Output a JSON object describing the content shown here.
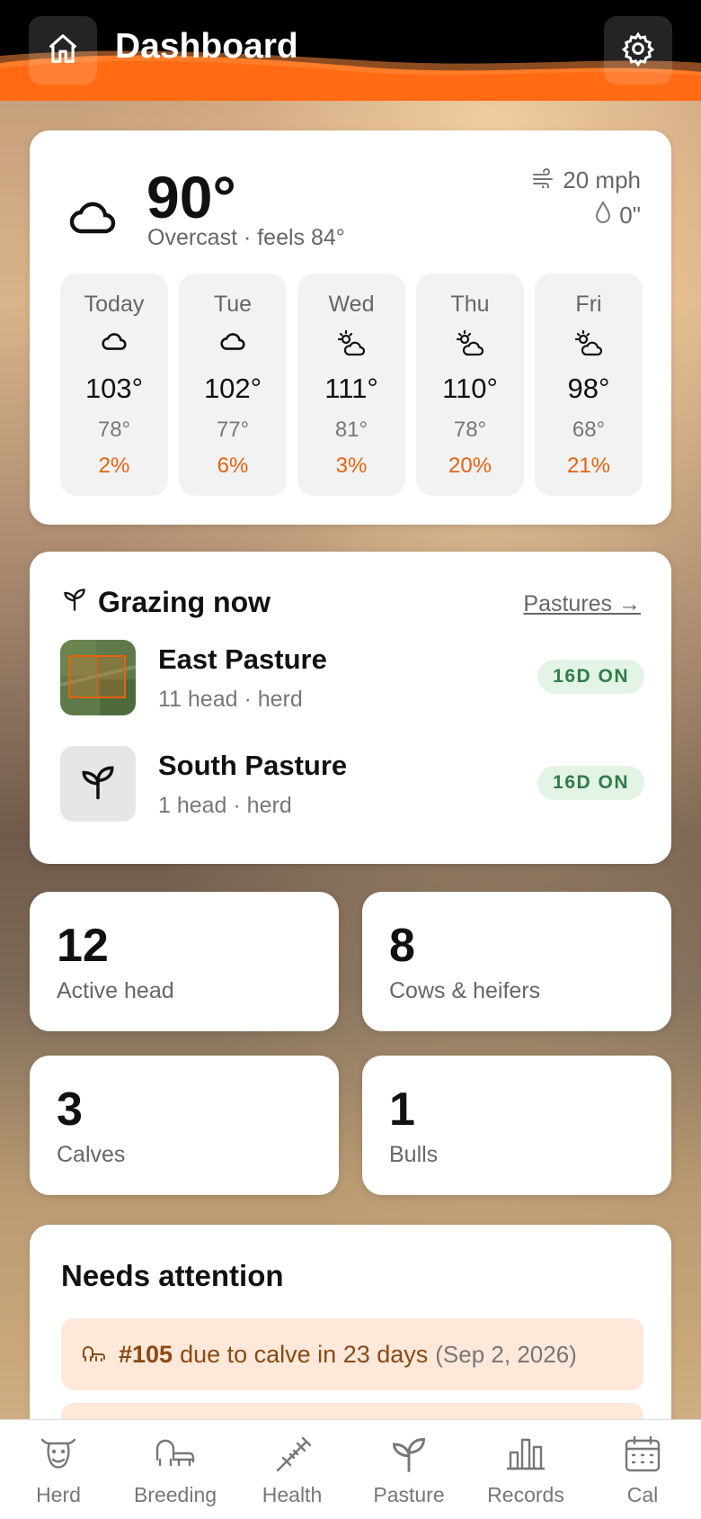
{
  "header": {
    "title": "Dashboard",
    "home_icon": "home-icon",
    "settings_icon": "gear-icon",
    "accent": "#ff6a13"
  },
  "weather": {
    "temp": "90°",
    "description": "Overcast · feels 84°",
    "wind": "20 mph",
    "rain": "0\"",
    "icon": "cloud-icon",
    "forecast": [
      {
        "day": "Today",
        "icon": "cloud-icon",
        "high": "103°",
        "low": "78°",
        "precip": "2%"
      },
      {
        "day": "Tue",
        "icon": "cloud-icon",
        "high": "102°",
        "low": "77°",
        "precip": "6%"
      },
      {
        "day": "Wed",
        "icon": "partly-cloudy-icon",
        "high": "111°",
        "low": "81°",
        "precip": "3%"
      },
      {
        "day": "Thu",
        "icon": "partly-cloudy-icon",
        "high": "110°",
        "low": "78°",
        "precip": "20%"
      },
      {
        "day": "Fri",
        "icon": "partly-cloudy-icon",
        "high": "98°",
        "low": "68°",
        "precip": "21%"
      }
    ]
  },
  "grazing": {
    "title": "Grazing now",
    "link": "Pastures →",
    "pastures": [
      {
        "name": "East Pasture",
        "sub": "11 head · herd",
        "badge": "16D ON"
      },
      {
        "name": "South Pasture",
        "sub": "1 head · herd",
        "badge": "16D ON"
      }
    ]
  },
  "stats": [
    {
      "num": "12",
      "label": "Active head"
    },
    {
      "num": "8",
      "label": "Cows & heifers"
    },
    {
      "num": "3",
      "label": "Calves"
    },
    {
      "num": "1",
      "label": "Bulls"
    }
  ],
  "attention": {
    "title": "Needs attention",
    "items": [
      {
        "tag": "#105",
        "text": "due to calve in 23 days",
        "date": "(Sep 2, 2026)"
      }
    ]
  },
  "nav": [
    {
      "label": "Herd",
      "icon": "cow-icon"
    },
    {
      "label": "Breeding",
      "icon": "breeding-icon"
    },
    {
      "label": "Health",
      "icon": "syringe-icon"
    },
    {
      "label": "Pasture",
      "icon": "sprout-icon"
    },
    {
      "label": "Records",
      "icon": "bar-chart-icon"
    },
    {
      "label": "Cal",
      "icon": "calendar-icon"
    }
  ]
}
